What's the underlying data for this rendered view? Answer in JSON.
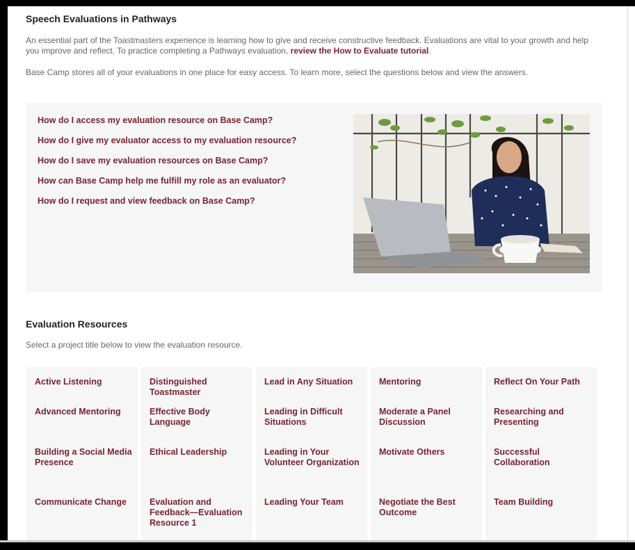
{
  "page": {
    "title": "Speech Evaluations in Pathways",
    "intro_text": "An essential part of the Toastmasters experience is learning how to give and receive constructive feedback. Evaluations are vital to your growth and help you improve and reflect. To practice completing a Pathways evaluation, ",
    "intro_link": "review the How to Evaluate tutorial",
    "intro_end": ".",
    "intro2": "Base Camp stores all of your evaluations in one place for easy access. To learn more, select the questions below and view the answers."
  },
  "faq": {
    "questions": [
      "How do I access my evaluation resource on Base Camp?",
      "How do I give my evaluator access to my evaluation resource?",
      "How do I save my evaluation resources on Base Camp?",
      "How can Base Camp help me fulfill my role as an evaluator?",
      "How do I request and view feedback on Base Camp?"
    ]
  },
  "resources": {
    "title": "Evaluation Resources",
    "subtitle": "Select a project title below to view the evaluation resource.",
    "columns": [
      [
        "Active Listening",
        "Advanced Mentoring",
        "Building a Social Media Presence",
        "Communicate Change"
      ],
      [
        "Distinguished Toastmaster",
        "Effective Body Language",
        "Ethical Leadership",
        "Evaluation and Feedback—Evaluation Resource 1"
      ],
      [
        "Lead in Any Situation",
        "Leading in Difficult Situations",
        "Leading in Your Volunteer Organization",
        "Leading Your Team"
      ],
      [
        "Mentoring",
        "Moderate a Panel Discussion",
        "Motivate Others",
        "Negotiate the Best Outcome"
      ],
      [
        "Reflect On Your Path",
        "Researching and Presenting",
        "Successful Collaboration",
        "Team Building"
      ]
    ]
  },
  "colors": {
    "link": "#772432",
    "panel": "#f6f6f6",
    "body_text": "#666666"
  }
}
